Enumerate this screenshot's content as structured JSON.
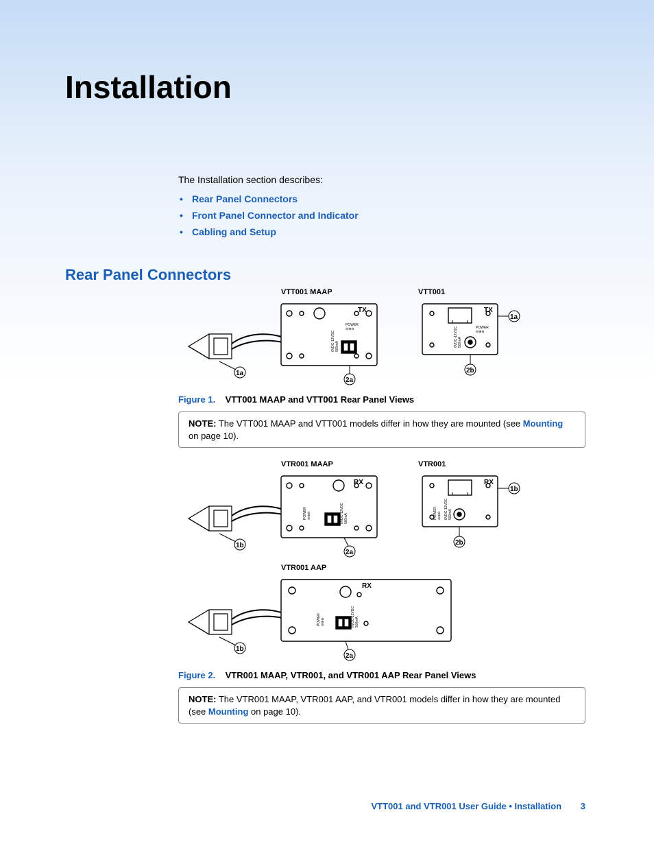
{
  "page_title": "Installation",
  "intro": "The Installation section describes:",
  "links": [
    "Rear Panel Connectors",
    "Front Panel Connector and Indicator",
    "Cabling and Setup"
  ],
  "section_heading": "Rear Panel Connectors",
  "diagrams": {
    "row1": {
      "maap": {
        "label": "VTT001 MAAP",
        "port_label": "TX",
        "callout_cable": "1a",
        "callout_power": "2a",
        "power_text": "POWER",
        "volt_text": "6VDC-12VDC\n500mA"
      },
      "std": {
        "label": "VTT001",
        "port_label": "TX",
        "callout_cable": "1a",
        "callout_power": "2b",
        "power_text": "POWER",
        "volt_text": "6VDC-12VDC\n500mA"
      }
    },
    "row2": {
      "maap": {
        "label": "VTR001 MAAP",
        "port_label": "RX",
        "callout_cable": "1b",
        "callout_power": "2a",
        "power_text": "POWER",
        "volt_text": "6VDC-12VDC\n500mA"
      },
      "std": {
        "label": "VTR001",
        "port_label": "RX",
        "callout_cable": "1b",
        "callout_power": "2b",
        "power_text": "POWER",
        "volt_text": "6VDC-12VDC\n500mA"
      }
    },
    "row3": {
      "aap": {
        "label": "VTR001 AAP",
        "port_label": "RX",
        "callout_cable": "1b",
        "callout_power": "2a",
        "power_text": "POWER",
        "volt_text": "6VDC-12VDC\n500mA"
      }
    }
  },
  "figure1": {
    "label": "Figure 1.",
    "text": "VTT001 MAAP and VTT001 Rear Panel Views"
  },
  "note1": {
    "label": "NOTE:",
    "text_before": "The VTT001 MAAP and VTT001 models differ in how they are mounted (see ",
    "link": "Mounting",
    "text_after": " on page 10)."
  },
  "figure2": {
    "label": "Figure 2.",
    "text": "VTR001 MAAP, VTR001, and VTR001 AAP Rear Panel Views"
  },
  "note2": {
    "label": "NOTE:",
    "text_before": "The VTR001 MAAP, VTR001 AAP, and VTR001 models differ in how they are mounted (see ",
    "link": "Mounting",
    "text_after": " on page 10)."
  },
  "footer": {
    "text": "VTT001 and VTR001 User Guide • Installation",
    "page": "3"
  }
}
